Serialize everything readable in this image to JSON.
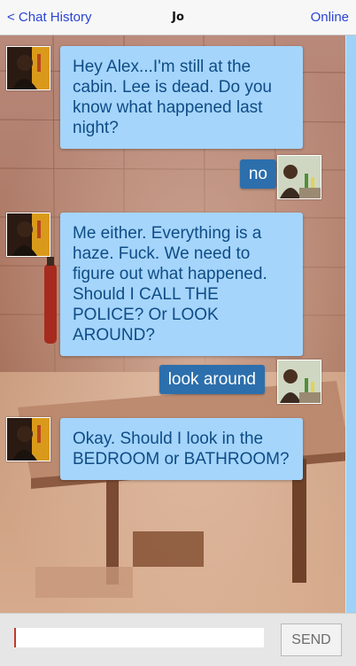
{
  "header": {
    "back_label": "< Chat History",
    "contact_name": "Jo",
    "status": "Online"
  },
  "messages": [
    {
      "sender": "Jo",
      "text": "Hey Alex...I'm still at the cabin. Lee is dead. Do you know what happened last night?"
    },
    {
      "sender": "Alex",
      "text": "no"
    },
    {
      "sender": "Jo",
      "text": "Me either. Everything is a haze. Fuck. We need to figure out what happened. Should I CALL THE POLICE? Or LOOK AROUND?"
    },
    {
      "sender": "Alex",
      "text": "look around"
    },
    {
      "sender": "Jo",
      "text": "Okay. Should I look in the BEDROOM or BATHROOM?"
    }
  ],
  "composer": {
    "input_value": "",
    "send_label": "SEND"
  },
  "colors": {
    "incoming_bubble": "#a5d5fb",
    "incoming_text": "#0f4c86",
    "outgoing_bubble": "#2c6fac",
    "header_link": "#2a44d6"
  }
}
